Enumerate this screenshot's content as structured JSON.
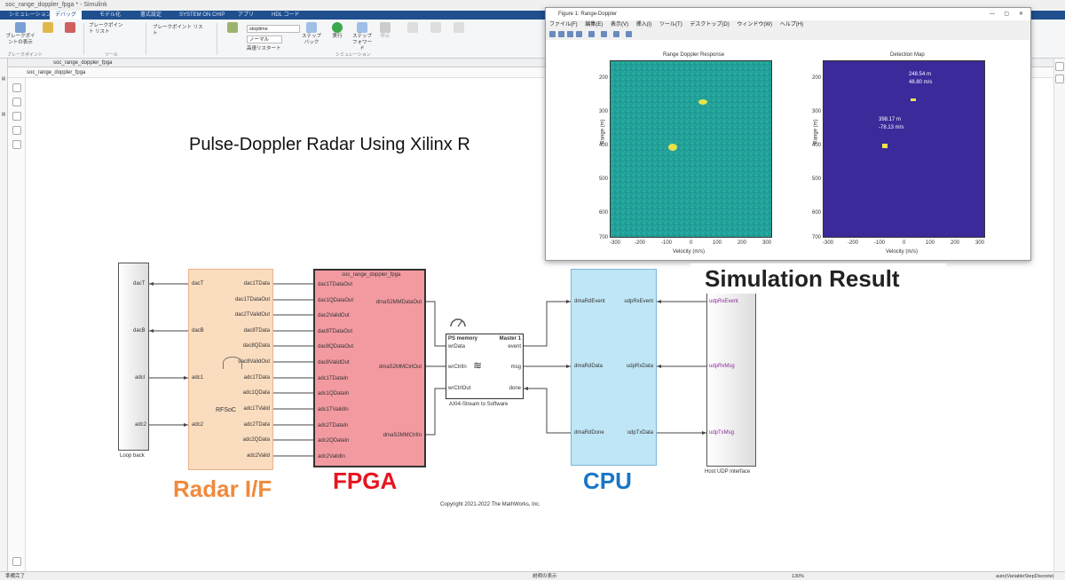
{
  "window": {
    "title": "soc_range_doppler_fpga * - Simulink"
  },
  "tabs": [
    "シミュレーション",
    "デバッグ",
    "モデル化",
    "書式設定",
    "SYSTEM ON CHIP",
    "アプリ",
    "HDL コード"
  ],
  "ribbon": {
    "buttons": [
      "ブレークポイントの表示",
      "ステップ バック",
      "実行",
      "ステップ フォワード",
      "停止",
      "ブレークポイント リスト",
      "高速リスタート",
      "ノーマル"
    ],
    "groups": [
      "ブレークポイント",
      "ツール",
      "シミュレーション"
    ],
    "stop_time": "stoptime"
  },
  "path": "soc_range_doppler_fpga",
  "breadcrumb": "soc_range_doppler_fpga",
  "canvas": {
    "title": "Pulse-Doppler Radar Using Xilinx R",
    "copyright": "Copyright 2021-2022 The MathWorks, Inc.",
    "loopback": {
      "label": "Loop back",
      "ports": [
        "dacT",
        "dacB",
        "adcI",
        "adc2"
      ]
    },
    "radar_if": {
      "label": "Radar I/F",
      "inner": "RFSoC",
      "left_ports": [
        "dacT",
        "dacB",
        "adc1",
        "adc2"
      ],
      "right_ports": [
        "dac1TData",
        "dac1TDataOut",
        "dac2TValidOut",
        "dac8TData",
        "dac8QData",
        "dac8ValidOut",
        "adc1TData",
        "adc1QData",
        "adc1TValid",
        "adc2TData",
        "adc2QData",
        "adc2Valid"
      ]
    },
    "fpga": {
      "label": "FPGA",
      "header": "soc_range_doppler_fpga",
      "left_ports": [
        "dac1TDataOut",
        "dac1QDataOut",
        "dac2ValidOut",
        "dac8TDataOut",
        "dac8QDataOut",
        "dac8ValidOut",
        "adc1TDataIn",
        "adc1QDataIn",
        "adc1TValidIn",
        "adc2TDataIn",
        "adc2QDataIn",
        "adc2ValidIn"
      ],
      "right_ports": [
        "dmaS2MMDataOut",
        "dmaS2MMCtrlOut",
        "dmaS2MMCtrlIn"
      ]
    },
    "axi": {
      "title_left": "PS memory",
      "title_right": "Master 1",
      "ports_left": [
        "wrData",
        "wrCtrlIn",
        "wrCtrlOut"
      ],
      "ports_right": [
        "event",
        "msg",
        "done"
      ],
      "caption": "AXI4-Stream to Software"
    },
    "cpu": {
      "label": "CPU",
      "left_ports": [
        "dmaRdEvent",
        "dmaRdData",
        "dmaRdDone"
      ],
      "right_ports": [
        "udpRxEvent",
        "udpRxData",
        "udpTxData"
      ]
    },
    "host": {
      "label": "Host UDP interface",
      "ports": [
        "udpRxEvent",
        "udpRxMsg",
        "udpTxMsg"
      ]
    },
    "sim_result": "Simulation Result"
  },
  "figure": {
    "title": "Figure 1: Range-Doppler",
    "menu": [
      "ファイル(F)",
      "編集(E)",
      "表示(V)",
      "挿入(I)",
      "ツール(T)",
      "デスクトップ(D)",
      "ウィンドウ(W)",
      "ヘルプ(H)"
    ],
    "plots": [
      {
        "title": "Range Doppler Response",
        "xlabel": "Velocity (m/s)",
        "ylabel": "Range (m)",
        "xticks": [
          "-300",
          "-200",
          "-100",
          "0",
          "100",
          "200",
          "300"
        ],
        "yticks": [
          "200",
          "300",
          "400",
          "500",
          "600",
          "700"
        ]
      },
      {
        "title": "Detection Map",
        "xlabel": "Velocity (m/s)",
        "ylabel": "Range (m)",
        "xticks": [
          "-300",
          "-200",
          "-100",
          "0",
          "100",
          "200",
          "300"
        ],
        "yticks": [
          "200",
          "300",
          "400",
          "500",
          "600",
          "700"
        ],
        "annotations": [
          {
            "line1": "248.54 m",
            "line2": "48.80 m/s"
          },
          {
            "line1": "398.17 m",
            "line2": "-78.13 m/s"
          }
        ]
      }
    ]
  },
  "status": {
    "left": "準備完了",
    "center": "説明の表示",
    "zoom": "130%",
    "right": "auto(VariableStepDiscrete)"
  },
  "colors": {
    "radar_if": "#fadcbf",
    "radar_label": "#f08a3c",
    "fpga": "#f29aa0",
    "fpga_label": "#e8141e",
    "cpu": "#bfe6f6",
    "cpu_label": "#1976c6",
    "map_bg": "#3a2a9a",
    "rdr_bg": "#24a39a"
  }
}
